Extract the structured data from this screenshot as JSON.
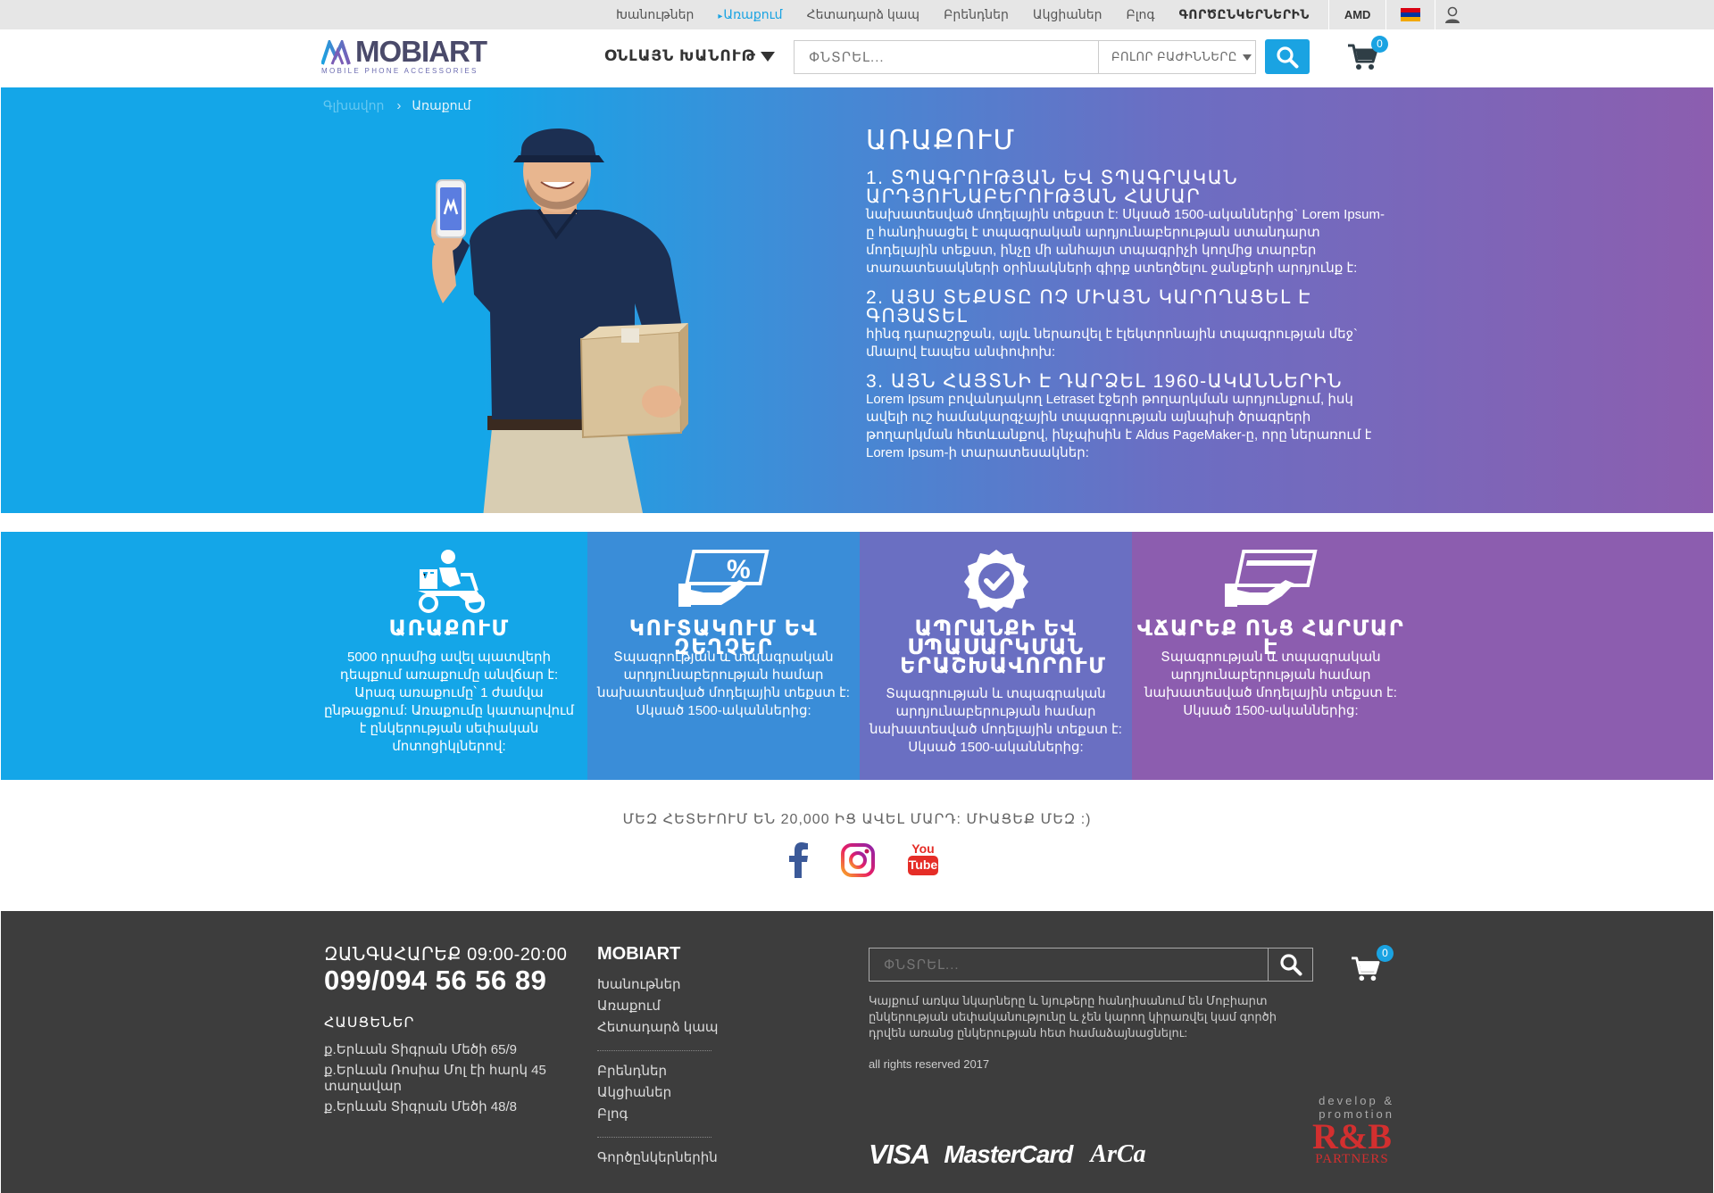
{
  "topnav": {
    "items": [
      {
        "label": "Խանութներ",
        "active": false
      },
      {
        "label": "Առաքում",
        "active": true
      },
      {
        "label": "Հետադարձ կապ",
        "active": false
      },
      {
        "label": "Բրենդներ",
        "active": false
      },
      {
        "label": "Ակցիաներ",
        "active": false
      },
      {
        "label": "Բլոգ",
        "active": false
      },
      {
        "label": "ԳՈՐԾԸՆԿԵՐՆԵՐԻՆ",
        "active": false
      }
    ],
    "currency": "AMD",
    "flag_colors": [
      "#d90012",
      "#0033a0",
      "#f2a800"
    ]
  },
  "header": {
    "logo_text": "MOBIART",
    "logo_sub": "MOBILE PHONE ACCESSORIES",
    "shop_menu": "ՕՆԼԱՅՆ ԽԱՆՈՒԹ",
    "search_placeholder": "ՓՆՏՐԵԼ...",
    "category_select": "ԲՈԼՈՐ ԲԱԺԻՆՆԵՐԸ",
    "cart_count": "0",
    "accent": "#1aa3e2"
  },
  "breadcrumb": {
    "home": "Գլխավոր",
    "current": "Առաքում"
  },
  "hero": {
    "title": "ԱՌԱՔՈՒՄ",
    "sections": [
      {
        "heading": "1. ՏՊԱԳՐՈՒԹՅԱՆ ԵՎ ՏՊԱԳՐԱԿԱՆ ԱՐԴՅՈՒՆԱԲԵՐՈՒԹՅԱՆ ՀԱՄԱՐ",
        "text": "նախատեսված մոդելային տեքստ է: Սկսած 1500-ականներից` Lorem Ipsum-ը հանդիսացել է տպագրական արդյունաբերության ստանդարտ մոդելային տեքստ, ինչը մի անհայտ տպագրիչի կողմից տարբեր տառատեսակների օրինակների գիրք ստեղծելու ջանքերի արդյունք է:"
      },
      {
        "heading": "2. ԱՅՍ ՏԵՔՍՏԸ ՈՉ ՄԻԱՅՆ ԿԱՐՈՂԱՑԵԼ Է ԳՈՅԱՏԵԼ",
        "text": "հինգ դարաշրջան, այլև ներառվել է էլեկտրոնային տպագրության մեջ` մնալով էապես անփոփոխ:"
      },
      {
        "heading": "3. ԱՅՆ ՀԱՅՏՆԻ Է ԴԱՐՁԵԼ 1960-ԱԿԱՆՆԵՐԻՆ",
        "text": "Lorem Ipsum բովանդակող Letraset էջերի թողարկման արդյունքում, իսկ ավելի ուշ համակարգչային տպագրության այնպիսի ծրագրերի թողարկման հետևանքով, ինչպիսին է Aldus PageMaker-ը, որը ներառում է Lorem Ipsum-ի տարատեսակներ:"
      }
    ]
  },
  "features": [
    {
      "title": "ԱՌԱՔՈՒՄ",
      "text": "5000 դրամից ավել պատվերի դեպքում առաքումը անվճար է: Արագ առաքումը՝ 1 ժամվա ընթացքում: Առաքումը կատարվում է ընկերության սեփական մոտոցիկլներով:",
      "color": "#14a6e8",
      "icon": "delivery-scooter-icon"
    },
    {
      "title": "ԿՈՒՏԱԿՈՒՄ ԵՎ ԶԵՂՉԵՐ",
      "text": "Տպագրության և տպագրական արդյունաբերության համար նախատեսված մոդելային տեքստ է: Սկսած 1500-ականներից:",
      "color": "#3a8dd8",
      "icon": "discount-card-icon"
    },
    {
      "title": "ԱՊՐԱՆՔԻ ԵՎ ՍՊԱՍԱՐԿՄԱՆ ԵՐԱՇԽԱՎՈՐՈՒՄ",
      "text": "Տպագրության և տպագրական արդյունաբերության համար նախատեսված մոդելային տեքստ է: Սկսած 1500-ականներից:",
      "color": "#6a6fc2",
      "icon": "guarantee-badge-icon"
    },
    {
      "title": "ՎՃԱՐԵՔ ՈՆՑ ՀԱՐՄԱՐ Է",
      "text": "Տպագրության և տպագրական արդյունաբերության համար նախատեսված մոդելային տեքստ է: Սկսած 1500-ականներից:",
      "color": "#8c5daf",
      "icon": "card-payment-icon"
    }
  ],
  "social": {
    "text": "ՄԵԶ ՀԵՏԵՒՈՒՄ ԵՆ 20,000 ԻՑ ԱՎԵԼ ՄԱՐԴ: ՄԻԱՑԵՔ ՄԵԶ :)",
    "youtube_label": "You",
    "youtube_label2": "Tube"
  },
  "footer": {
    "call_label": "ԶԱՆԳԱՀԱՐԵՔ 09:00-20:00",
    "phone": "099/094 56 56 89",
    "addresses_title": "ՀԱՍՑԵՆԵՐ",
    "addresses": [
      "ք.Երևան Տիգրան Մեծի 65/9",
      "ք.Երևան Ռոսիա Մոլ էի հարկ 45 տաղավար",
      "ք.Երևան Տիգրան Մեծի 48/8"
    ],
    "brand": "MOBIART",
    "links_group1": [
      "Խանութներ",
      "Առաքում",
      "Հետադարձ կապ"
    ],
    "links_group2": [
      "Բրենդներ",
      "Ակցիաներ",
      "Բլոգ"
    ],
    "links_group3": [
      "Գործընկերներին"
    ],
    "search_placeholder": "ՓՆՏՐԵԼ...",
    "cart_count": "0",
    "note": "Կայքում առկա նկարները և նյութերը հանդիսանում են Մոբիարտ ընկերության սեփականությունը և չեն կարող կիրառվել կամ գործի դրվեն առանց ընկերության հետ համաձայնացնելու:",
    "rights": "all rights reserved 2017",
    "payments": [
      "VISA",
      "MasterCard",
      "ArCa"
    ],
    "developer_small": "develop & promotion",
    "developer_big": "R&B",
    "developer_sub": "PARTNERS"
  }
}
